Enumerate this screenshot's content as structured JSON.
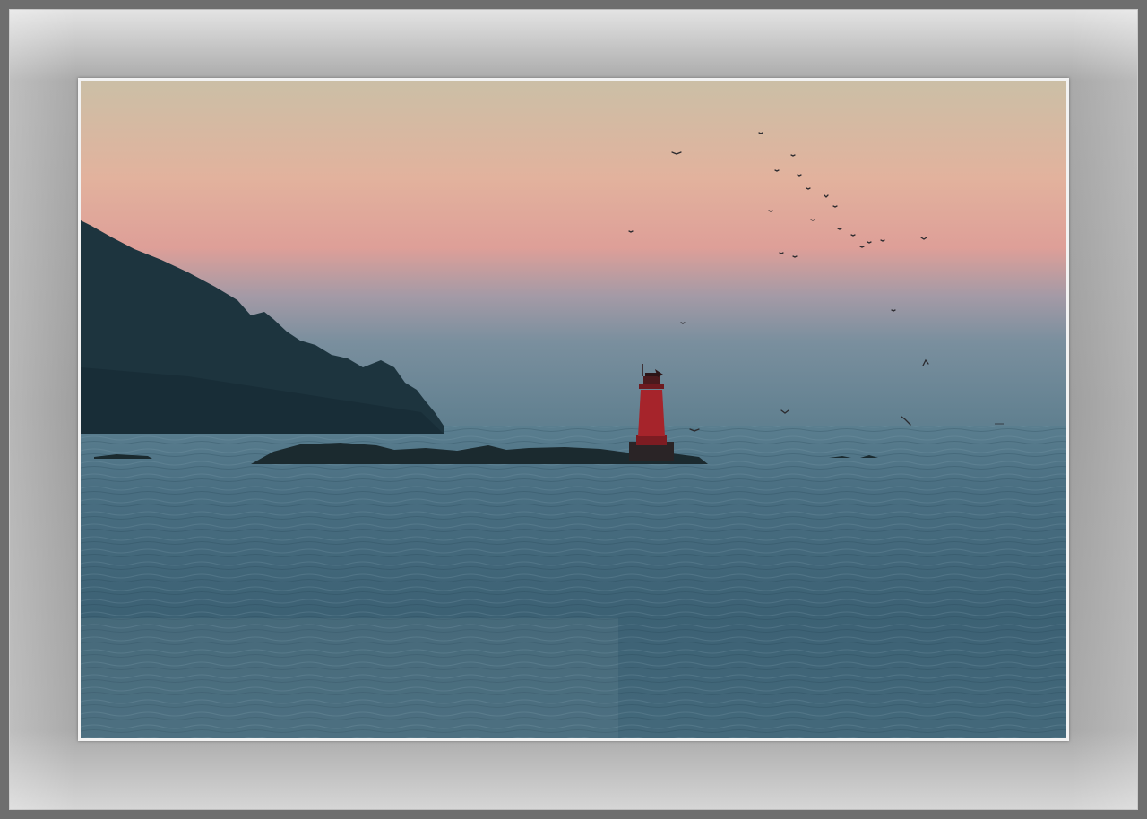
{
  "scene": {
    "subject": "lighthouse",
    "colors": {
      "sky_top": "#c9bfa9",
      "sky_mid": "#e0a99a",
      "sky_low": "#8f9aaa",
      "horizon": "#5f7f8f",
      "sea_far": "#4e7386",
      "sea_near": "#3a5d70",
      "headland": "#1f3640",
      "rocks": "#1a2a2f",
      "lighthouse": "#a8232a",
      "frame": "#a0a0a0"
    }
  }
}
